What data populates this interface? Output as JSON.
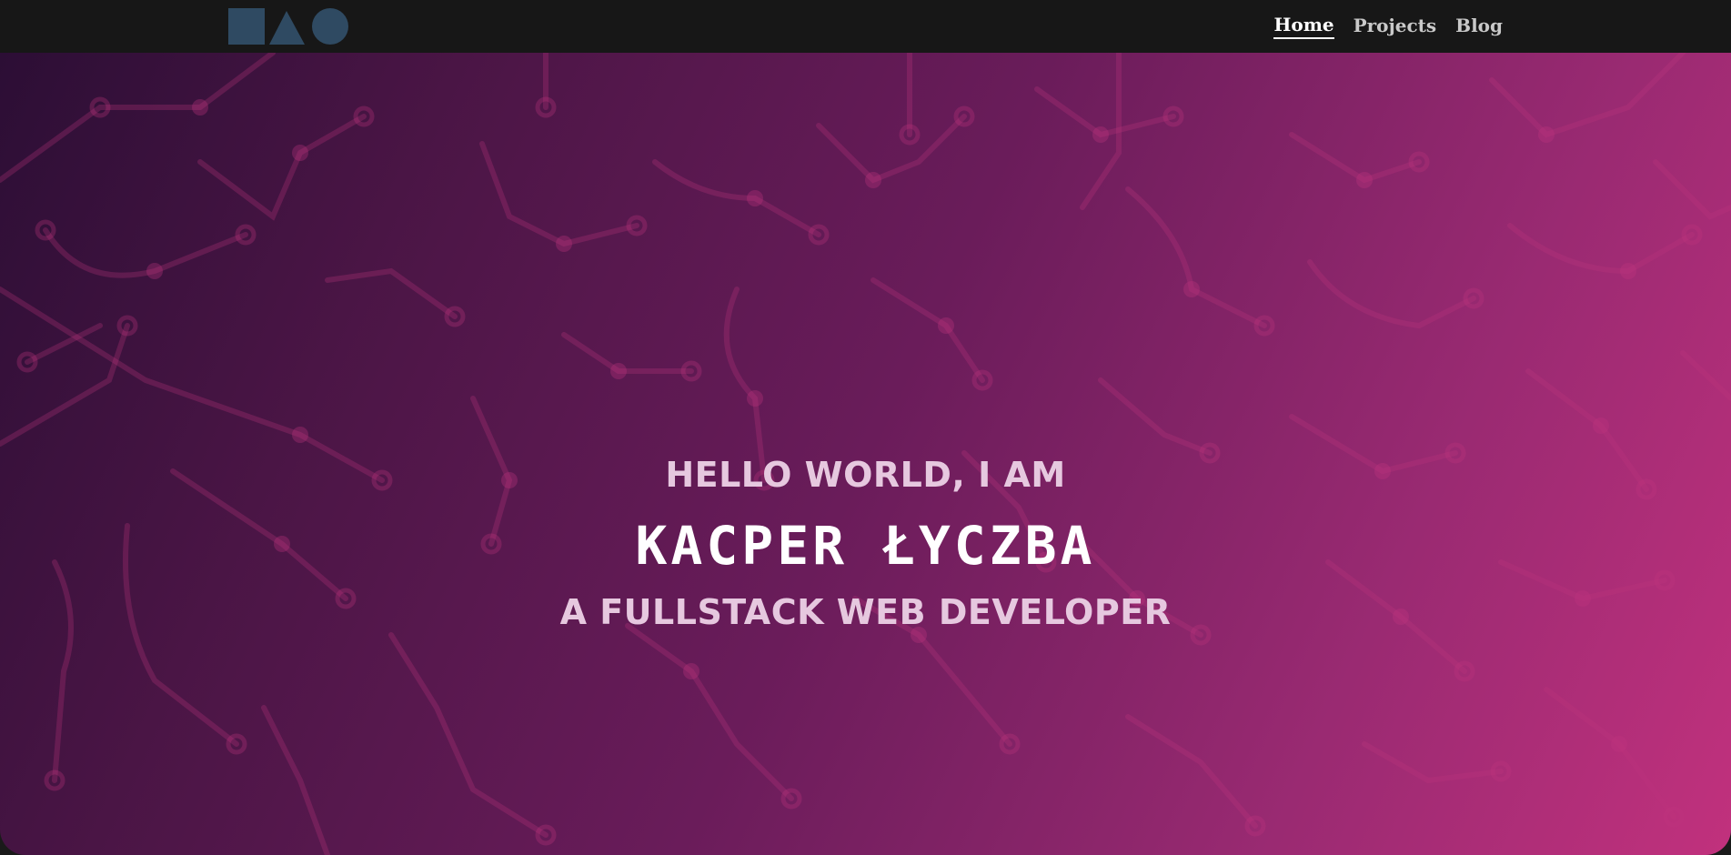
{
  "nav": {
    "logo_icon": "shapes-logo-icon",
    "links": [
      {
        "label": "Home",
        "active": true
      },
      {
        "label": "Projects",
        "active": false
      },
      {
        "label": "Blog",
        "active": false
      }
    ]
  },
  "hero": {
    "greeting": "HELLO WORLD, I AM",
    "name": "KACPER ŁYCZBA",
    "role": "A FULLSTACK WEB DEVELOPER",
    "background_pattern": "circuit-pattern"
  },
  "colors": {
    "navbar_bg": "#171717",
    "logo": "#2f4a62",
    "gradient_start": "#2c0e35",
    "gradient_end": "#c1317d",
    "circuit_line": "#c0357f"
  }
}
